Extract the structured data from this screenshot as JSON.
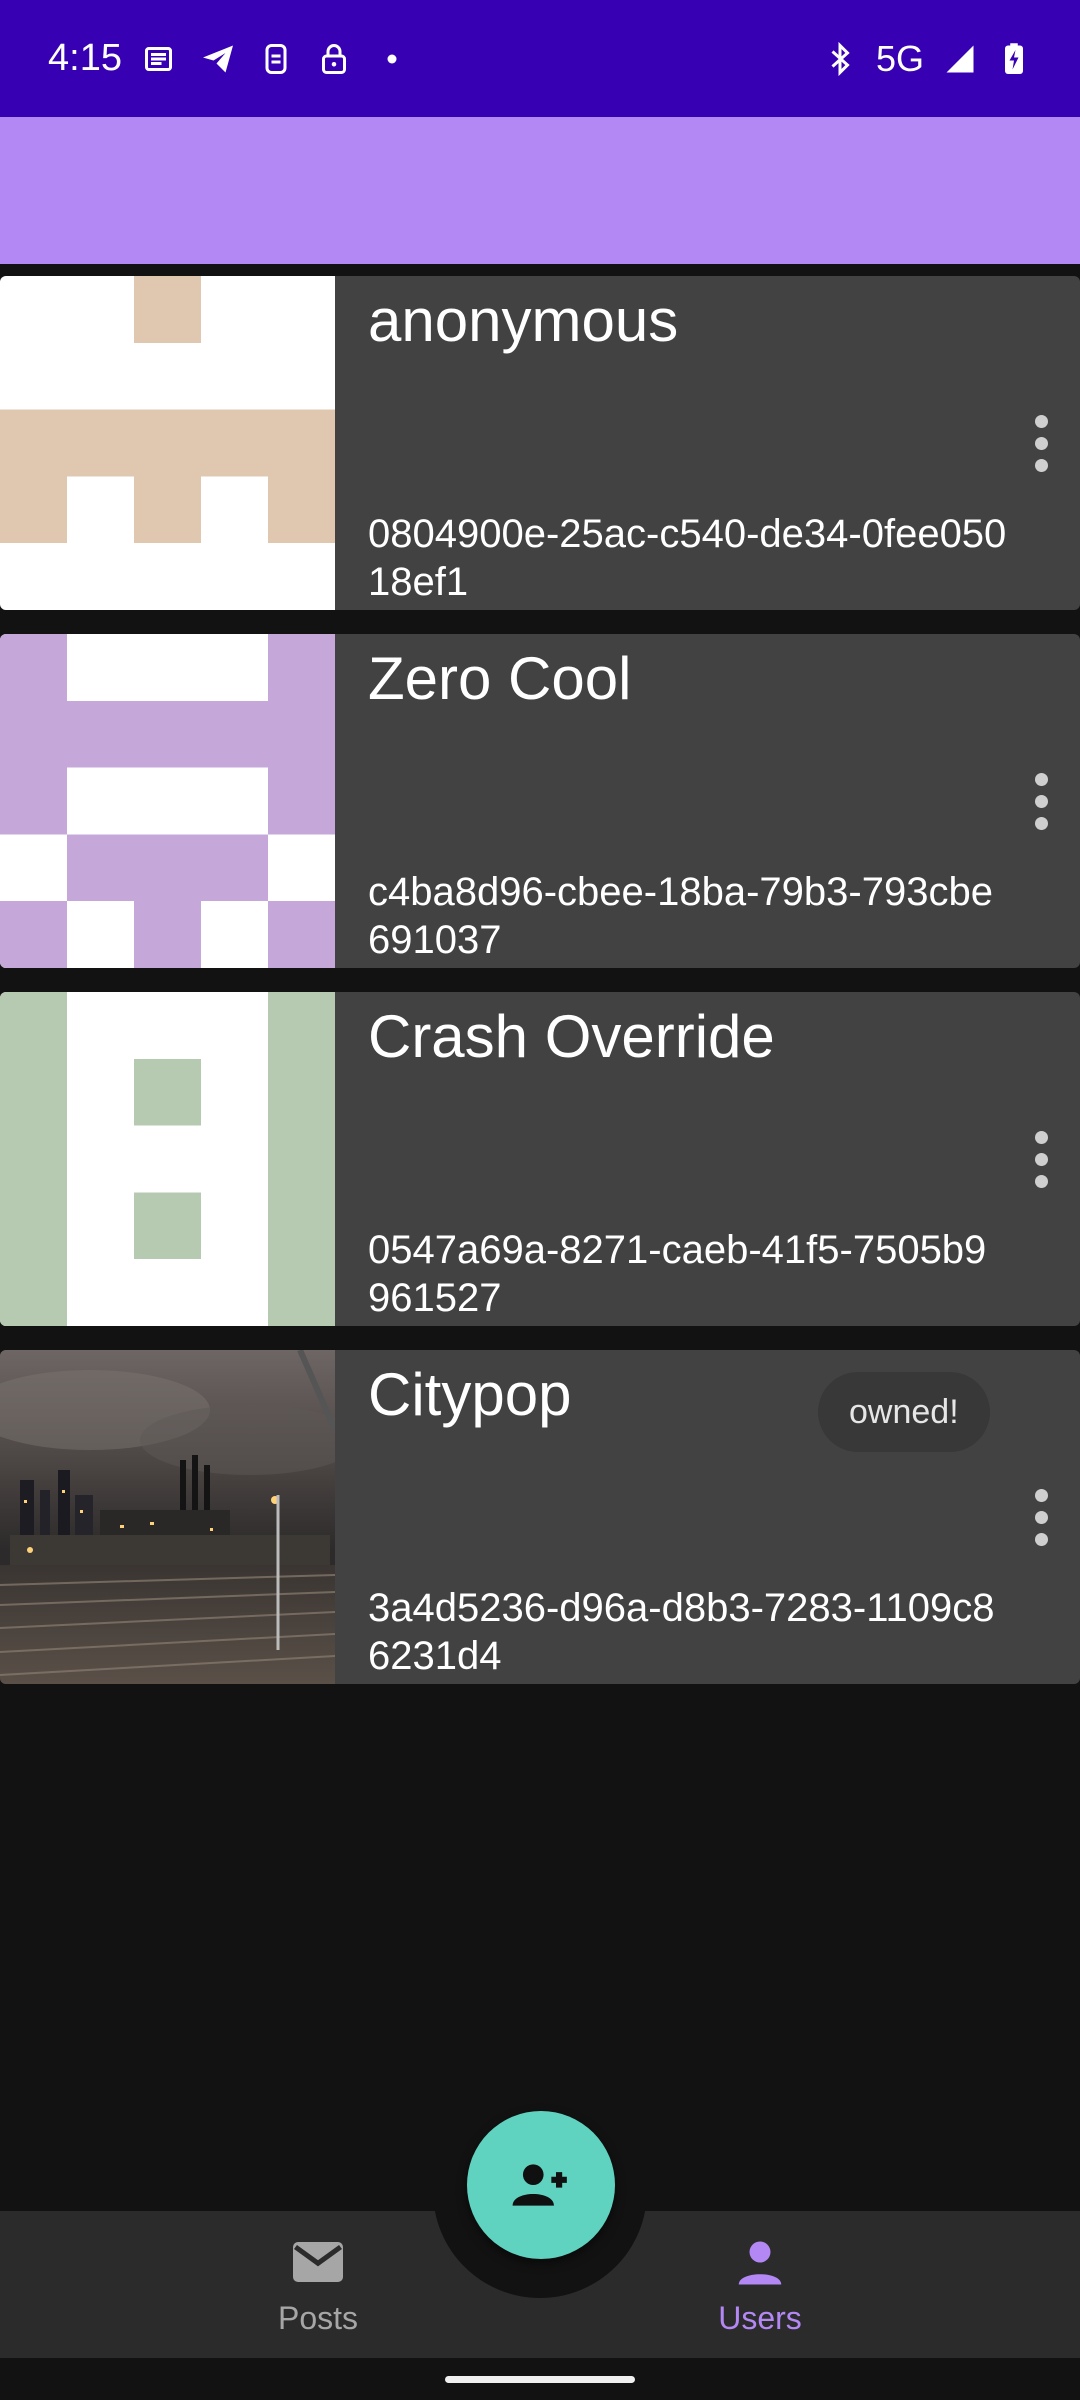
{
  "status_bar": {
    "time": "4:15",
    "network": "5G",
    "left_icons": [
      "news-icon",
      "telegram-icon",
      "sim-icon",
      "lock-icon",
      "dot-icon"
    ],
    "right_icons": [
      "bluetooth-icon",
      "signal-icon",
      "battery-charging-icon"
    ]
  },
  "users": [
    {
      "name": "anonymous",
      "id": "0804900e-25ac-c540-de34-0fee05018ef1",
      "avatar_color": "#dfc8af",
      "owned": false
    },
    {
      "name": "Zero Cool",
      "id": "c4ba8d96-cbee-18ba-79b3-793cbe691037",
      "avatar_color": "#c5a8d9",
      "owned": false
    },
    {
      "name": "Crash Override",
      "id": "0547a69a-8271-caeb-41f5-7505b9961527",
      "avatar_color": "#b6c9b1",
      "owned": false
    },
    {
      "name": "Citypop",
      "id": "3a4d5236-d96a-d8b3-7283-1109c86231d4",
      "avatar_type": "photo",
      "owned": true,
      "owned_label": "owned!"
    }
  ],
  "fab": {
    "icon": "person-add-icon",
    "color": "#5fd3c0"
  },
  "bottom_nav": {
    "items": [
      {
        "label": "Posts",
        "icon": "mail-icon",
        "selected": false
      },
      {
        "label": "Users",
        "icon": "person-icon",
        "selected": true
      }
    ],
    "selected_color": "#b388f4",
    "unselected_color": "#a6a6a6"
  }
}
